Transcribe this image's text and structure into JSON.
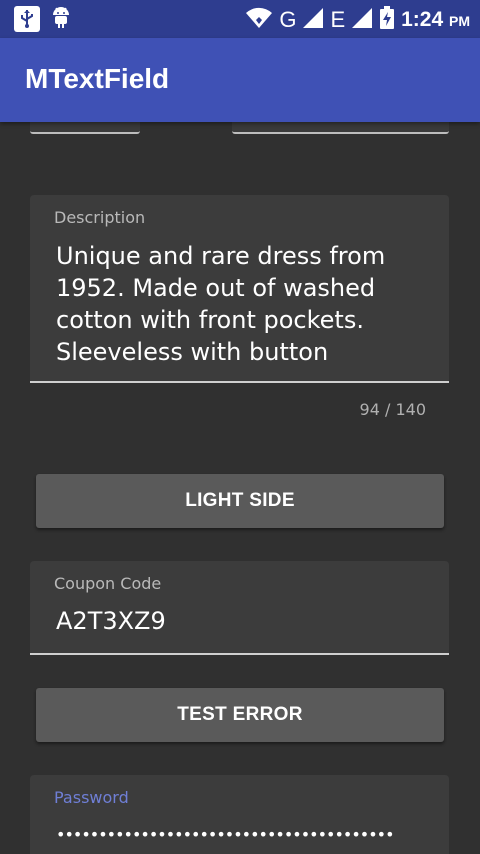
{
  "status_bar": {
    "icons": [
      "usb-icon",
      "android-icon",
      "wifi-icon",
      "signal-icon",
      "signal-icon",
      "battery-charging-icon"
    ],
    "network_g": "G",
    "network_e": "E",
    "time": "1:24",
    "ampm": "PM"
  },
  "appbar": {
    "title": "MTextField"
  },
  "description": {
    "label": "Description",
    "value": "Unique and rare dress from 1952. Made out of washed cotton with front pockets. Sleeveless with button",
    "counter": "94 / 140"
  },
  "light_side_button": "LIGHT SIDE",
  "coupon": {
    "label": "Coupon Code",
    "value": "A2T3XZ9"
  },
  "test_error_button": "TEST ERROR",
  "password": {
    "label": "Password",
    "label_color": "#6f7fd6",
    "value": "••••••••••••••••••••••••••••••••••••••••"
  },
  "colors": {
    "primary": "#3f51b5",
    "primary_dark": "#2e3d8f",
    "background": "#303030"
  }
}
